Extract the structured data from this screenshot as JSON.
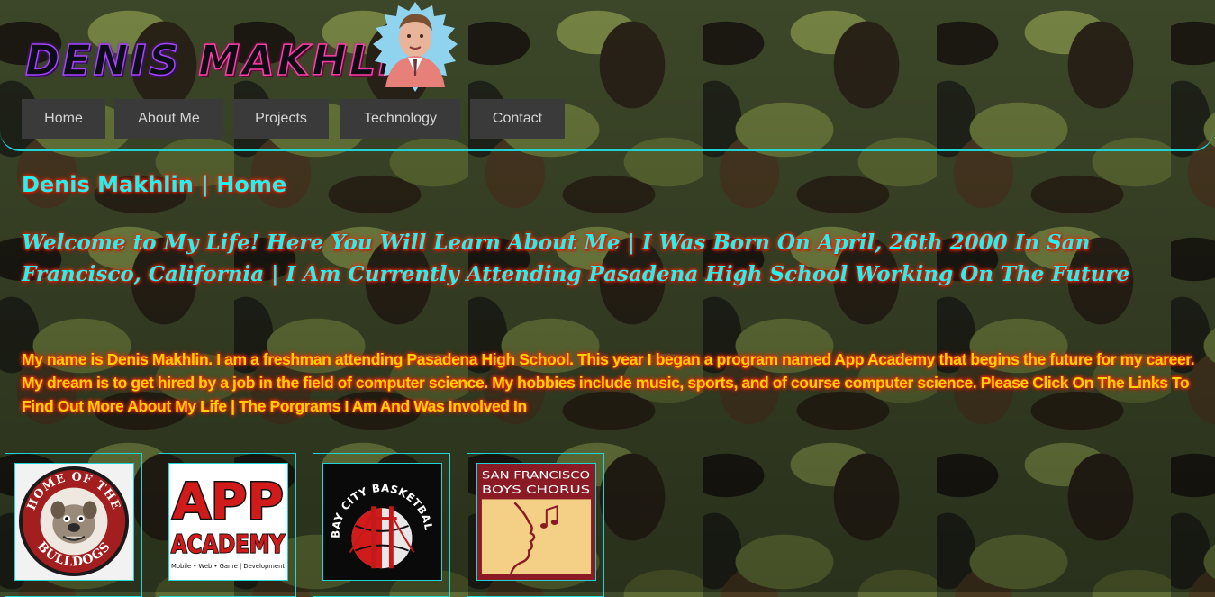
{
  "site": {
    "logo_first": "DENIS",
    "logo_last": "MAKHLIN"
  },
  "nav": {
    "items": [
      {
        "label": "Home"
      },
      {
        "label": "About Me"
      },
      {
        "label": "Projects"
      },
      {
        "label": "Technology"
      },
      {
        "label": "Contact"
      }
    ]
  },
  "main": {
    "heading": "Denis Makhlin | Home",
    "welcome": "Welcome to My Life! Here You Will Learn About Me | I Was Born On April, 26th 2000 In San Francisco, California | I Am Currently Attending Pasadena High School Working On The Future",
    "bio": "My name is Denis Makhlin. I am a freshman attending Pasadena High School. This year I began a program named App Academy that begins the future for my career. My dream is to get hired by a job in the field of computer science. My hobbies include music, sports, and of course computer science. Please Click On The Links To Find Out More About My Life | The Porgrams I Am And Was Involved In"
  },
  "cards": [
    {
      "name": "home-of-the-bulldogs",
      "top_text": "HOME OF THE",
      "bottom_text": "BULLDOGS"
    },
    {
      "name": "app-academy",
      "title_1": "APP",
      "title_2": "ACADEMY",
      "tagline": "Mobile • Web • Game | Development"
    },
    {
      "name": "bay-city-basketball",
      "arc_text": "BAY CITY BASKETBALL"
    },
    {
      "name": "sf-boys-chorus",
      "line_1": "SAN FRANCISCO",
      "line_2": "BOYS CHORUS"
    }
  ],
  "colors": {
    "accent_cyan": "#25f0f0",
    "bio_yellow": "#ffd200",
    "glow_red": "#ff2a00",
    "nav_bg": "#3a3a3a",
    "border_cyan": "#22d3d3"
  }
}
